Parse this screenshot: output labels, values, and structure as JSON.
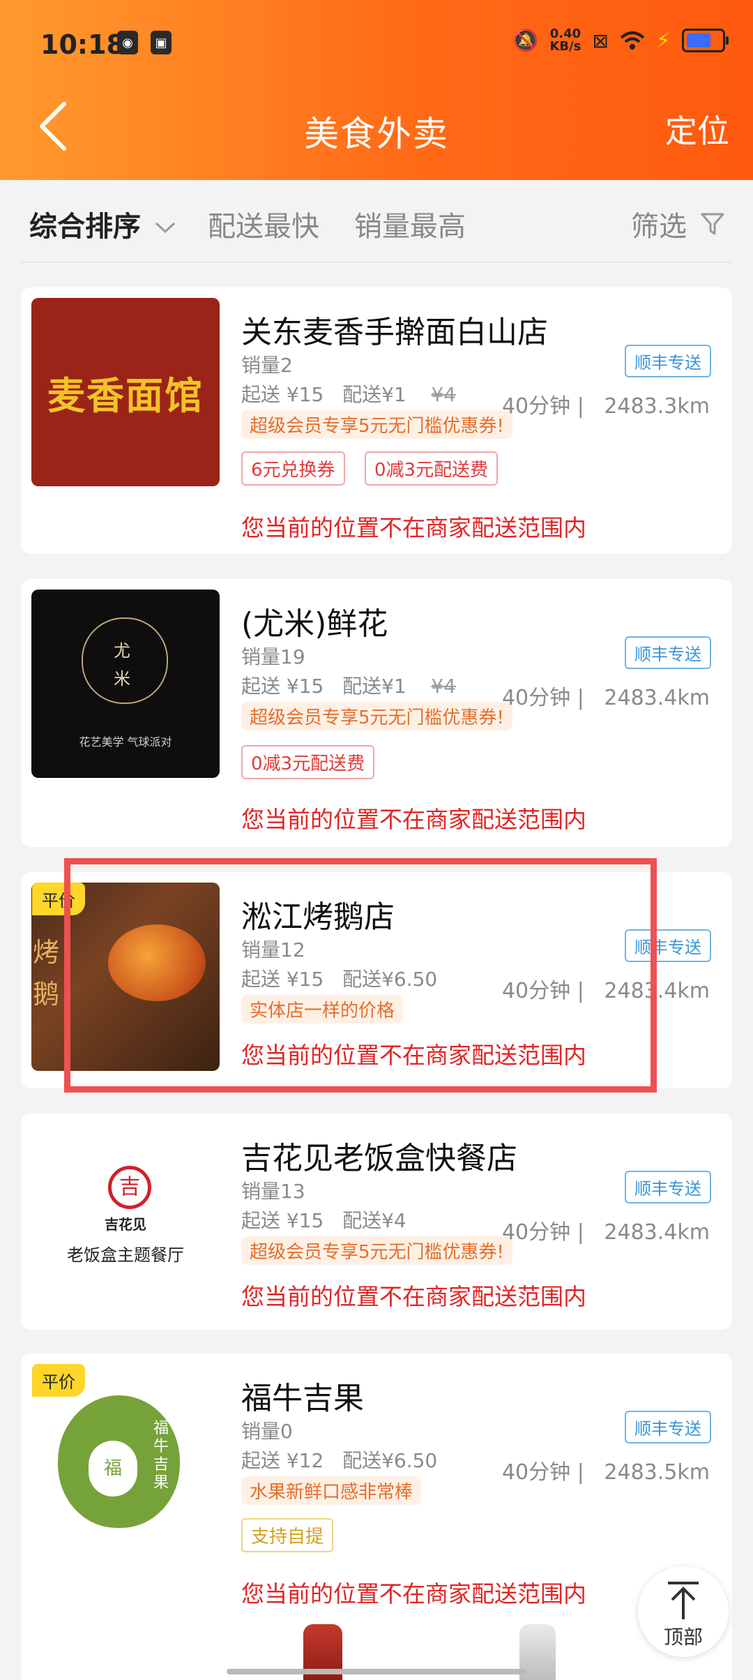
{
  "status": {
    "time": "10:18",
    "net_speed_value": "0.40",
    "net_speed_unit": "KB/s"
  },
  "header": {
    "title": "美食外卖",
    "locate_label": "定位"
  },
  "sort": {
    "items": [
      "综合排序",
      "配送最快",
      "销量最高"
    ],
    "filter_label": "筛选"
  },
  "stores": [
    {
      "name": "关东麦香手擀面白山店",
      "thumb_text": "麦香面馆",
      "sales": "销量2",
      "min_order": "起送 ¥15",
      "delivery_fee": "配送¥1",
      "original_fee": "¥4",
      "promo": "超级会员专享5元无门槛优惠券!",
      "tags": [
        "6元兑换券",
        "0减3元配送费"
      ],
      "warning": "您当前的位置不在商家配送范围内",
      "shipper": "顺丰专送",
      "time": "40分钟",
      "distance": "2483.3km"
    },
    {
      "name": "(尤米)鲜花",
      "thumb_logo_char_1": "尤",
      "thumb_logo_char_2": "米",
      "thumb_tagline": "花艺美学  气球派对",
      "sales": "销量19",
      "min_order": "起送 ¥15",
      "delivery_fee": "配送¥1",
      "original_fee": "¥4",
      "promo": "超级会员专享5元无门槛优惠券!",
      "tags": [
        "0减3元配送费"
      ],
      "warning": "您当前的位置不在商家配送范围内",
      "shipper": "顺丰专送",
      "time": "40分钟",
      "distance": "2483.4km"
    },
    {
      "name": "淞江烤鹅店",
      "badge": "平价",
      "thumb_text": "烤鹅",
      "sales": "销量12",
      "min_order": "起送 ¥15",
      "delivery_fee": "配送¥6.50",
      "promo": "实体店一样的价格",
      "warning": "您当前的位置不在商家配送范围内",
      "shipper": "顺丰专送",
      "time": "40分钟",
      "distance": "2483.4km"
    },
    {
      "name": "吉花见老饭盒快餐店",
      "thumb_logo_char": "吉",
      "thumb_brand": "吉花见",
      "thumb_caption": "老饭盒主题餐厅",
      "sales": "销量13",
      "min_order": "起送 ¥15",
      "delivery_fee": "配送¥4",
      "promo": "超级会员专享5元无门槛优惠券!",
      "warning": "您当前的位置不在商家配送范围内",
      "shipper": "顺丰专送",
      "time": "40分钟",
      "distance": "2483.4km"
    },
    {
      "name": "福牛吉果",
      "badge": "平价",
      "thumb_logo_char": "福",
      "thumb_vertical": "福牛吉果",
      "sales": "销量0",
      "min_order": "起送 ¥12",
      "delivery_fee": "配送¥6.50",
      "promo": "水果新鲜口感非常棒",
      "tags": [
        "支持自提"
      ],
      "warning": "您当前的位置不在商家配送范围内",
      "shipper": "顺丰专送",
      "time": "40分钟",
      "distance": "2483.5km"
    }
  ],
  "to_top_label": "顶部"
}
